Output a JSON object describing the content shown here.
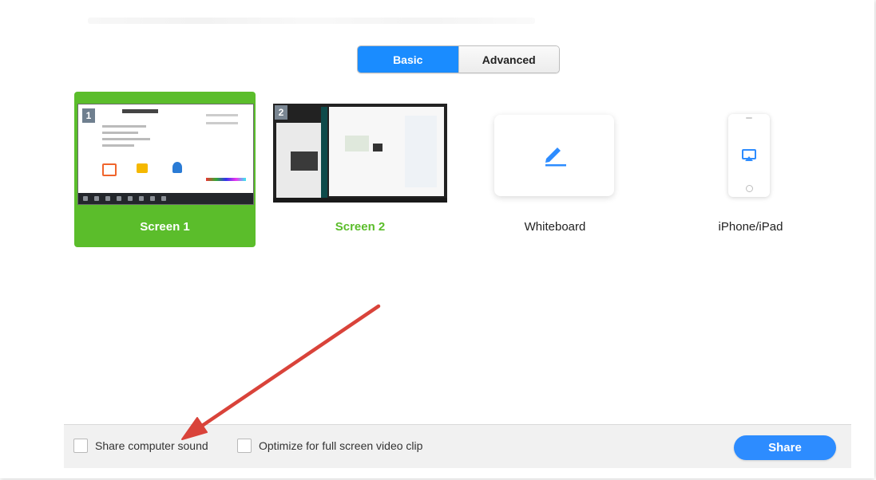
{
  "tabs": [
    {
      "label": "Basic",
      "active": true
    },
    {
      "label": "Advanced",
      "active": false
    }
  ],
  "options": [
    {
      "label": "Screen 1",
      "badge": "1",
      "selected": true
    },
    {
      "label": "Screen 2",
      "badge": "2",
      "selected": false
    },
    {
      "label": "Whiteboard",
      "icon": "pen-icon"
    },
    {
      "label": "iPhone/iPad",
      "icon": "airplay-icon"
    }
  ],
  "bottom": {
    "share_sound_label": "Share computer sound",
    "optimize_label": "Optimize for full screen video clip",
    "share_button": "Share"
  },
  "annotation": {
    "arrow_color": "#d9433a"
  },
  "colors": {
    "accent_blue": "#2d8cff",
    "selected_green": "#5bbd2b"
  }
}
